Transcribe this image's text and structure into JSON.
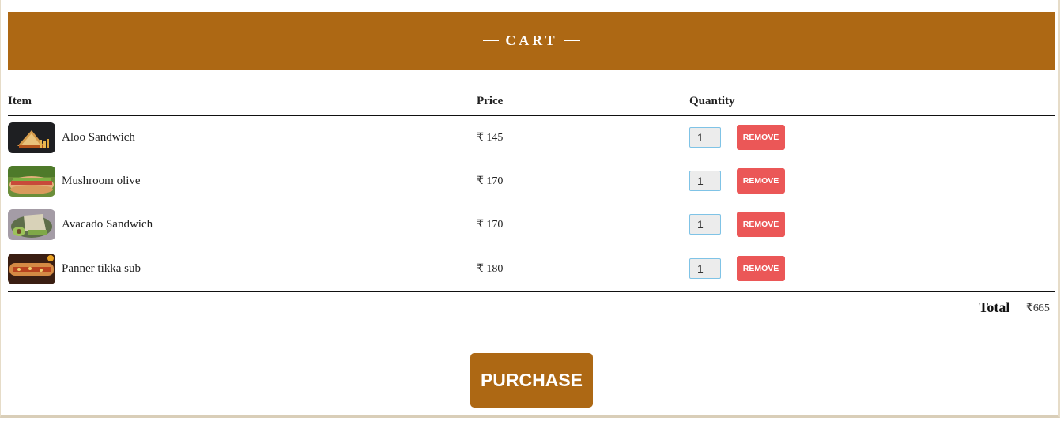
{
  "header": {
    "title": "CART"
  },
  "table": {
    "columns": [
      "Item",
      "Price",
      "Quantity"
    ]
  },
  "items": [
    {
      "name": "Aloo Sandwich",
      "price": "₹ 145",
      "quantity": "1",
      "remove_label": "REMOVE",
      "image": "sandwich-photo"
    },
    {
      "name": "Mushroom olive",
      "price": "₹ 170",
      "quantity": "1",
      "remove_label": "REMOVE",
      "image": "sub-photo"
    },
    {
      "name": "Avacado Sandwich",
      "price": "₹ 170",
      "quantity": "1",
      "remove_label": "REMOVE",
      "image": "avocado-sandwich-photo"
    },
    {
      "name": "Panner tikka sub",
      "price": "₹ 180",
      "quantity": "1",
      "remove_label": "REMOVE",
      "image": "tikka-sub-photo"
    }
  ],
  "summary": {
    "total_label": "Total",
    "total_value": "₹665"
  },
  "actions": {
    "purchase_label": "PURCHASE"
  },
  "colors": {
    "brand": "#ad6814",
    "remove": "#eb5757"
  }
}
